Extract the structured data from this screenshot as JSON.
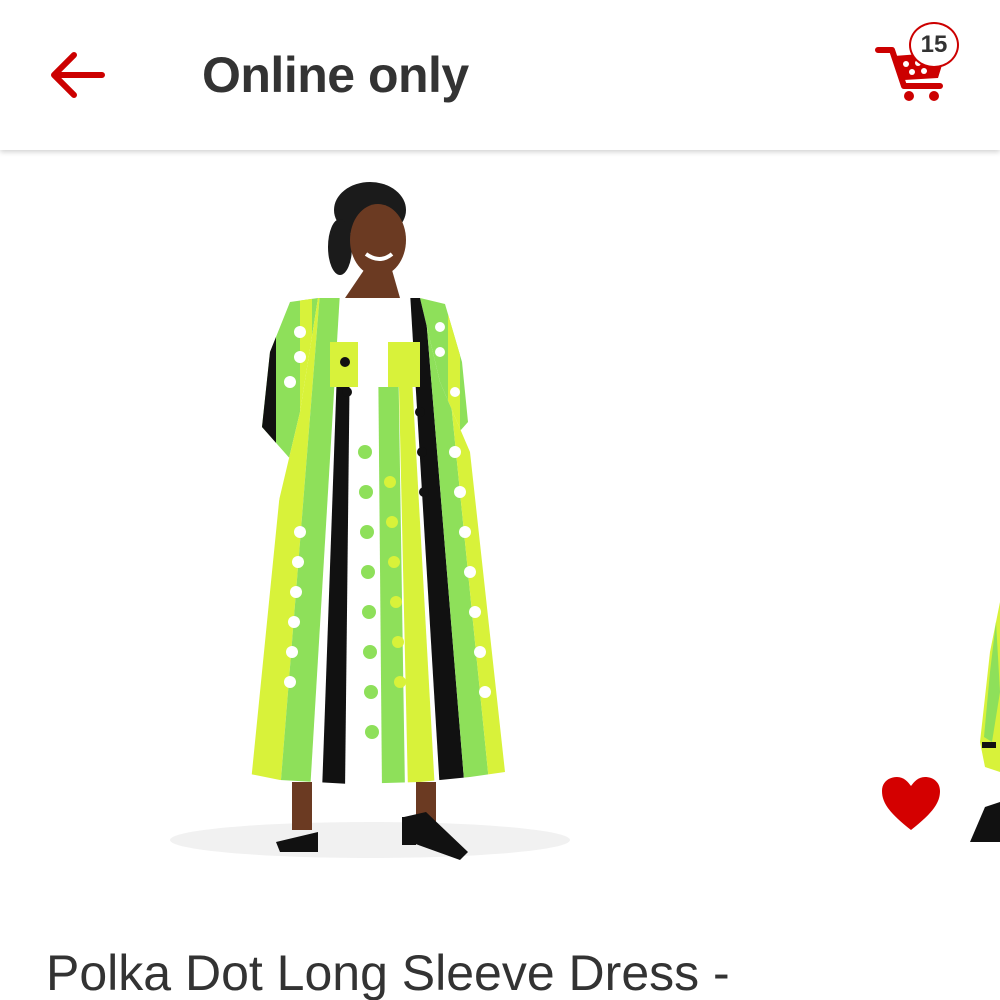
{
  "header": {
    "title": "Online only",
    "back_icon": "arrow-left-icon",
    "cart_icon": "shopping-cart-icon",
    "cart_count": "15"
  },
  "product": {
    "title": "Polka Dot Long Sleeve Dress -",
    "image_description_icon": "product-photo",
    "favorite_icon": "heart-icon"
  },
  "colors": {
    "accent": "#cc0000",
    "heart": "#d40000",
    "text": "#333333",
    "dress_green": "#8ee05a",
    "dress_lime": "#d8f23a"
  }
}
